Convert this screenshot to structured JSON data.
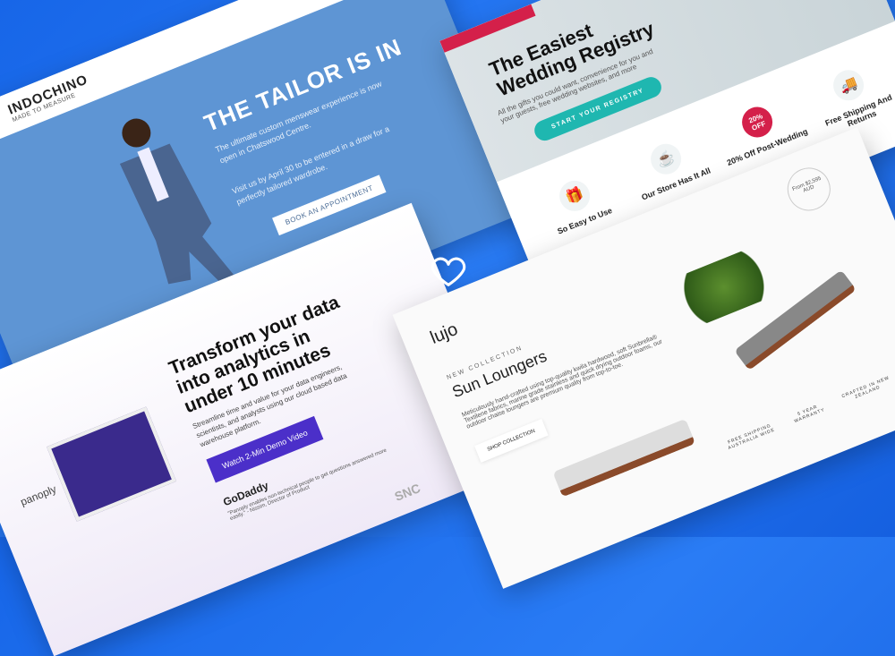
{
  "tailor": {
    "logo": "INDOCHINO",
    "logo_sub": "MADE TO MEASURE",
    "title": "THE TAILOR IS IN",
    "p1": "The ultimate custom menswear experience is now open in Chatswood Centre.",
    "p2": "Visit us by April 30 to be entered in a draw for a perfectly tailored wardrobe.",
    "button": "BOOK AN APPOINTMENT"
  },
  "registry": {
    "title1": "The Easiest",
    "title2": "Wedding Registry",
    "sub": "All the gifts you could want, convenience for you and your guests, free wedding websites, and more",
    "button": "START YOUR REGISTRY",
    "features": [
      {
        "icon": "gift-icon",
        "label": "So Easy to Use"
      },
      {
        "icon": "mixer-icon",
        "label": "Our Store Has It All"
      },
      {
        "icon": "discount-badge-icon",
        "badge": "20% OFF",
        "label": "20% Off Post-Wedding"
      },
      {
        "icon": "truck-icon",
        "label": "Free Shipping And Returns"
      }
    ]
  },
  "panoply": {
    "logo": "panoply",
    "title": "Transform your data into analytics in under 10 minutes",
    "sub": "Streamline time and value for your data engineers, scientists, and analysts using our cloud based data warehouse platform.",
    "button": "Watch 2-Min Demo Video",
    "client": "GoDaddy",
    "quote": "\"Panoply enables non-technical people to get questions answered more easily.\" - Nissim, Director of Product",
    "client2": "SNC"
  },
  "lujo": {
    "logo": "lujo",
    "price": "From $2,595 AUD",
    "eyebrow": "NEW COLLECTION",
    "title": "Sun Loungers",
    "sub": "Meticulously hand-crafted using top-quality kwila hardwood, soft Sunbrella® Textilene fabrics, marine grade stainless and quick drying outdoor foams, our outdoor chaise loungers are premium quality from top-to-toe.",
    "button": "SHOP COLLECTION",
    "badges": [
      "FREE SHIPPING AUSTRALIA WIDE",
      "5 YEAR WARRANTY",
      "CRAFTED IN NEW ZEALAND"
    ]
  },
  "colors": {
    "background": "#1a6ff0",
    "teal": "#1fb7b0",
    "purple": "#4b2fc9",
    "red": "#d4204a"
  },
  "center_icon": "heart-icon"
}
